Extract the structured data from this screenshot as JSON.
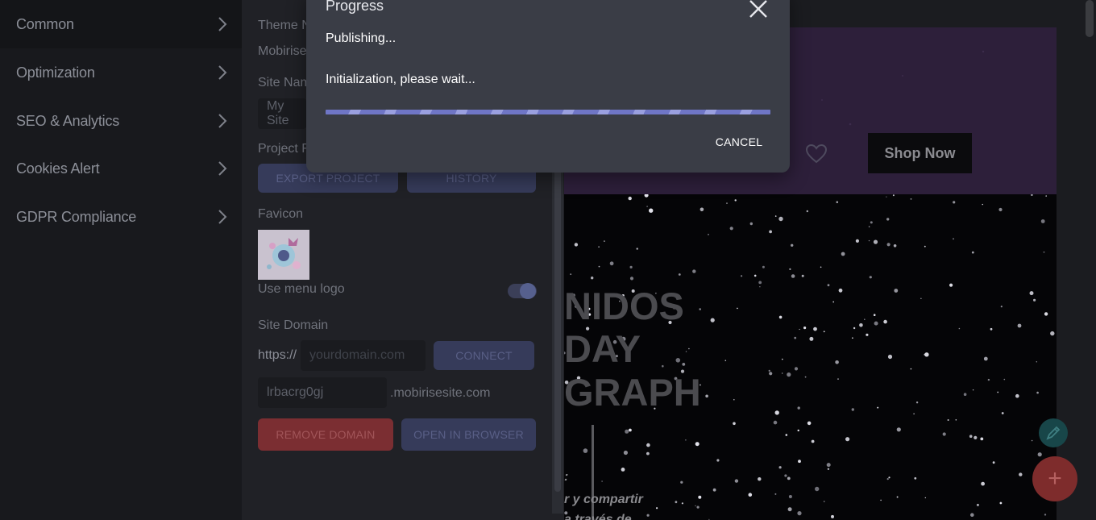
{
  "sidebar": {
    "items": [
      {
        "label": "Common"
      },
      {
        "label": "Optimization"
      },
      {
        "label": "SEO & Analytics"
      },
      {
        "label": "Cookies Alert"
      },
      {
        "label": "GDPR Compliance"
      }
    ]
  },
  "settings": {
    "theme_label": "Theme N",
    "theme_value": "Mobirise",
    "site_name_label": "Site Nam",
    "site_name_value": "My Site",
    "project_label": "Project F",
    "export_button": "EXPORT PROJECT",
    "history_button": "HISTORY",
    "favicon_label": "Favicon",
    "menu_logo_label": "Use menu logo",
    "menu_logo_enabled": true,
    "site_domain_label": "Site Domain",
    "https_prefix": "https://",
    "domain_placeholder": "yourdomain.com",
    "connect_button": "CONNECT",
    "subdomain_value": "lrbacrg0gj",
    "subdomain_suffix": ".mobirisesite.com",
    "remove_domain_button": "REMOVE DOMAIN",
    "open_browser_button": "OPEN IN BROWSER"
  },
  "preview": {
    "shop_button": "Shop Now",
    "headline_lines": [
      "NIDOS",
      "DAY",
      "GRAPH"
    ],
    "sub_lines": [
      ":",
      "r y compartir",
      "a través de"
    ],
    "add_button": "+"
  },
  "modal": {
    "title": "Progress",
    "status": "Publishing...",
    "message": "Initialization, please wait...",
    "cancel_label": "CANCEL",
    "progress": "indeterminate"
  },
  "colors": {
    "accent": "#5c63b0",
    "danger": "#7b2e32",
    "teal": "#184649"
  },
  "icons": {
    "chevron": "chevron-right-icon",
    "close": "close-icon",
    "heart": "heart-icon",
    "pen": "pen-icon",
    "add": "plus-icon"
  }
}
